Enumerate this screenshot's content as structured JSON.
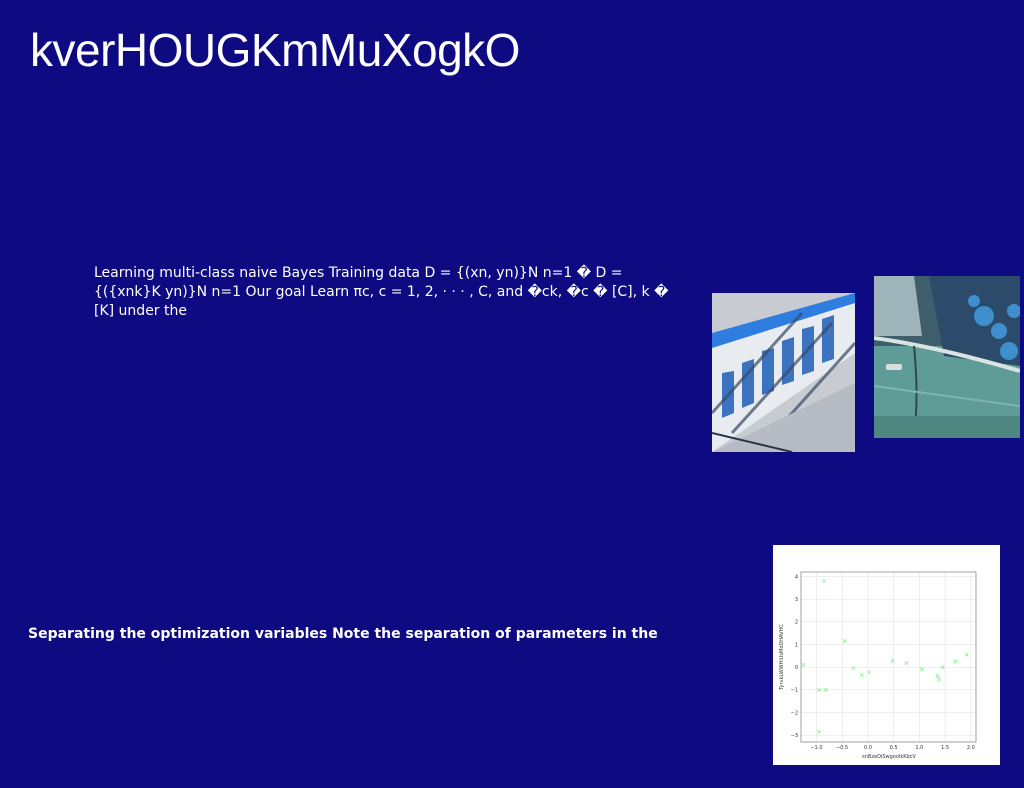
{
  "slide": {
    "title": "kverHOUGKmMuXogkO",
    "body_text": "Learning multi-class naive Bayes Training data D = {(xn, yn)}N n=1 � D = {({xnk}K yn)}N n=1 Our goal Learn πc, c = 1, 2, · · · , C, and �ck, �c � [C], k � [K] under the",
    "subheading": "Separating the optimization variables Note the separation of parameters in the",
    "background_color": "#0d0a82"
  },
  "images": [
    {
      "name": "photo-staircase",
      "description": "blue and white staircase with diagonal shadows"
    },
    {
      "name": "photo-vintage-car",
      "description": "teal vintage car side view with leaves reflected in window"
    }
  ],
  "chart_data": {
    "type": "scatter",
    "title": "",
    "xlabel": "snBzeOiSwgoolkKbcV",
    "ylabel": "TyrvkLWWHiUsMoDHAVHC",
    "xlim": [
      -1.3,
      2.1
    ],
    "ylim": [
      -3.3,
      4.2
    ],
    "xticks": [
      "−1.0",
      "−0.5",
      "0.0",
      "0.5",
      "1.0",
      "1.5",
      "2.0"
    ],
    "yticks": [
      "−3",
      "−2",
      "−1",
      "0",
      "1",
      "2",
      "3",
      "4"
    ],
    "xtick_values": [
      -1.0,
      -0.5,
      0.0,
      0.5,
      1.0,
      1.5,
      2.0
    ],
    "ytick_values": [
      -3,
      -2,
      -1,
      0,
      1,
      2,
      3,
      4
    ],
    "grid": true,
    "marker": "x",
    "marker_color": "#90ee90",
    "points": [
      {
        "x": -1.25,
        "y": 0.1
      },
      {
        "x": -0.95,
        "y": -1.0
      },
      {
        "x": -0.95,
        "y": -2.85
      },
      {
        "x": -0.85,
        "y": 3.8
      },
      {
        "x": -0.82,
        "y": -1.0
      },
      {
        "x": -0.45,
        "y": 1.15
      },
      {
        "x": -0.28,
        "y": -0.05
      },
      {
        "x": -0.12,
        "y": -0.35
      },
      {
        "x": 0.02,
        "y": -0.22
      },
      {
        "x": 0.48,
        "y": 0.28
      },
      {
        "x": 0.75,
        "y": 0.18
      },
      {
        "x": 1.05,
        "y": -0.1
      },
      {
        "x": 1.35,
        "y": -0.4
      },
      {
        "x": 1.38,
        "y": -0.55
      },
      {
        "x": 1.45,
        "y": 0.0
      },
      {
        "x": 1.7,
        "y": 0.25
      },
      {
        "x": 1.92,
        "y": 0.55
      }
    ]
  }
}
